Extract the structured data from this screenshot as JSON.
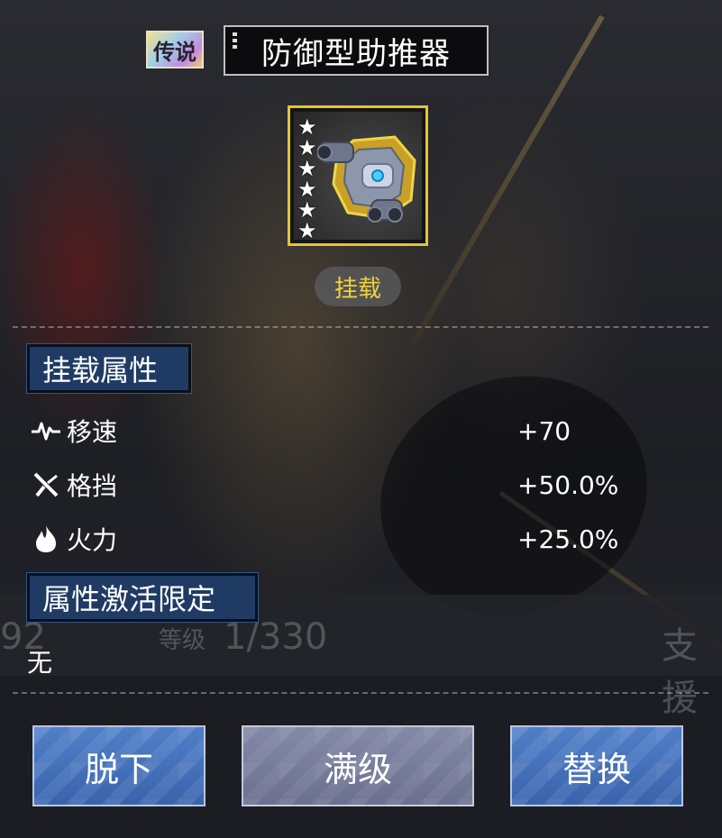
{
  "header": {
    "rarity_badge": "传说",
    "item_name": "防御型助推器"
  },
  "item": {
    "stars": 6,
    "slot_tag": "挂载"
  },
  "attributes": {
    "title": "挂载属性",
    "rows": [
      {
        "icon": "speed-icon",
        "label": "移速",
        "value": "+70"
      },
      {
        "icon": "block-icon",
        "label": "格挡",
        "value": "+50.0%"
      },
      {
        "icon": "fire-icon",
        "label": "火力",
        "value": "+25.0%"
      }
    ]
  },
  "activation": {
    "title": "属性激活限定",
    "value": "无"
  },
  "background": {
    "ghost_number": "92",
    "level_label": "等级",
    "level_value": "1/330",
    "support_label": "支援"
  },
  "actions": {
    "unequip": "脱下",
    "max_level": "满级",
    "replace": "替换"
  },
  "colors": {
    "legend_gold": "#e3c436",
    "tag_text": "#f0d23a",
    "section_blue": "#1f3b64",
    "button_blue": "#4f7fc8",
    "button_gray": "#8389a6"
  }
}
